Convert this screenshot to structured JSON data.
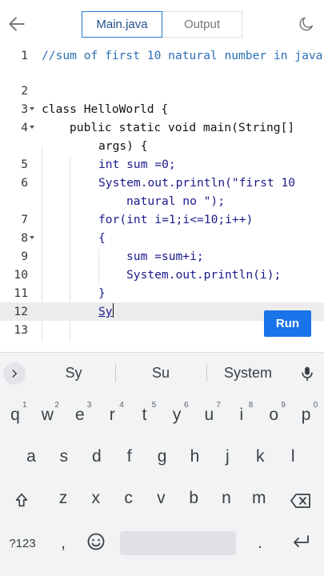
{
  "header": {
    "back_icon": "arrow-left-icon",
    "tabs": [
      {
        "label": "Main.java",
        "active": true
      },
      {
        "label": "Output",
        "active": false
      }
    ],
    "theme_icon": "moon-icon"
  },
  "editor": {
    "lines": [
      {
        "num": "1",
        "text": "//sum of first 10 natural number in java"
      },
      {
        "num": "2",
        "text": ""
      },
      {
        "num": "3",
        "text": "class HelloWorld {"
      },
      {
        "num": "4",
        "text": "public static void main(String[]",
        "wrap": "args) {"
      },
      {
        "num": "5",
        "text": "int sum =0;"
      },
      {
        "num": "6",
        "text": "System.out.println(\"first 10",
        "wrap": "natural no \");"
      },
      {
        "num": "7",
        "text": "for(int i=1;i<=10;i++)"
      },
      {
        "num": "8",
        "text": "{"
      },
      {
        "num": "9",
        "text": "sum =sum+i;"
      },
      {
        "num": "10",
        "text": "System.out.println(i);"
      },
      {
        "num": "11",
        "text": "}"
      },
      {
        "num": "12",
        "text": "Sy"
      },
      {
        "num": "13",
        "text": ""
      }
    ],
    "active_line": "12"
  },
  "run_label": "Run",
  "keyboard": {
    "suggestions": [
      "Sy",
      "Su",
      "System"
    ],
    "row1": [
      "q",
      "w",
      "e",
      "r",
      "t",
      "y",
      "u",
      "i",
      "o",
      "p"
    ],
    "row1_hints": [
      "1",
      "2",
      "3",
      "4",
      "5",
      "6",
      "7",
      "8",
      "9",
      "0"
    ],
    "row2": [
      "a",
      "s",
      "d",
      "f",
      "g",
      "h",
      "j",
      "k",
      "l"
    ],
    "row3": [
      "z",
      "x",
      "c",
      "v",
      "b",
      "n",
      "m"
    ],
    "symbols_label": "?123",
    "comma": ",",
    "period": "."
  }
}
